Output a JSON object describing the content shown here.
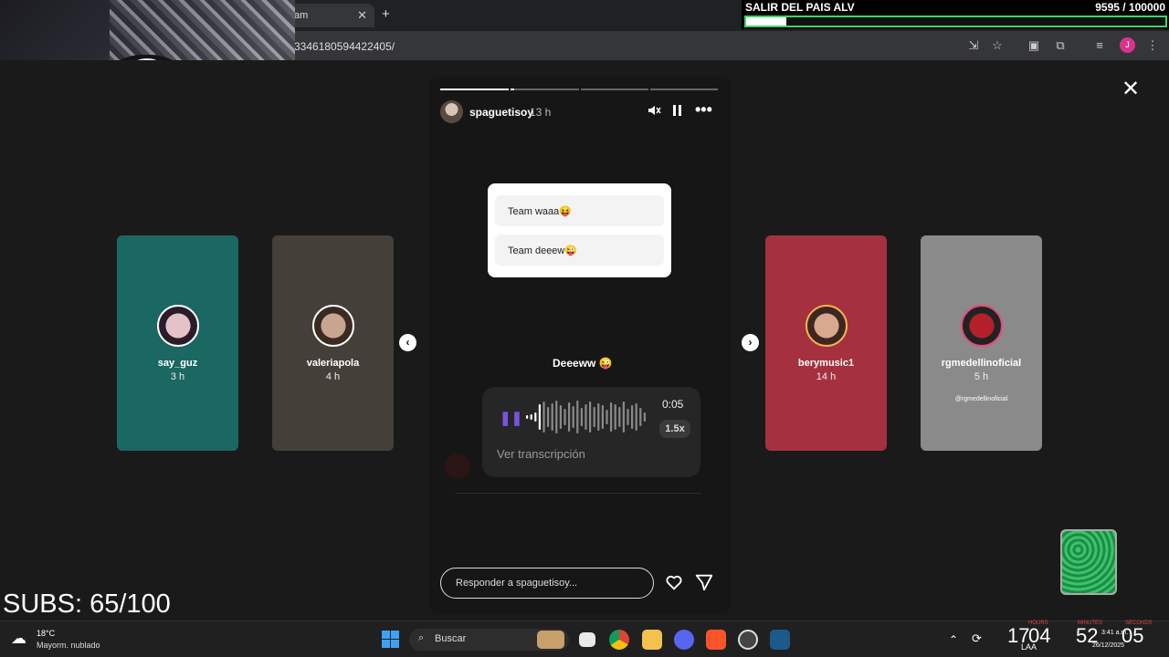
{
  "browser": {
    "tab_title_fragment": "am",
    "tab_close": "✕",
    "new_tab": "+",
    "url_fragment": "3346180594422405/",
    "profile_initial": "J",
    "toolbar_icons": [
      "install-icon",
      "star-icon",
      "tab-search-icon",
      "extensions-icon",
      "media-icon",
      "profile-icon",
      "more-icon"
    ]
  },
  "goal": {
    "title": "SALIR DEL PAIS ALV",
    "count": "9595  / 100000",
    "progress": 0.095,
    "bar_color": "#3bd46a"
  },
  "story": {
    "username": "spaguetisoy",
    "time": "13 h",
    "segments": [
      1.0,
      0.0,
      0.0,
      0.0
    ],
    "current_segment_progress": 0.05,
    "poll_options": [
      "Team waaa😝",
      "Team deeew😜"
    ],
    "caption": "Deeeww 😜",
    "voice_message": {
      "duration": "0:05",
      "speed": "1.5x",
      "transcription_link": "Ver transcripción",
      "accent": "#7a53e0"
    },
    "reply_placeholder": "Responder a spaguetisoy...",
    "close": "✕"
  },
  "side_stories": {
    "left": [
      {
        "name": "say_guz",
        "time": "3 h",
        "bg": "#2a9e96"
      },
      {
        "name": "valeriapola",
        "time": "4 h",
        "bg": "#6b6158"
      }
    ],
    "right": [
      {
        "name": "berymusic1",
        "time": "14 h",
        "bg": "#c23a4c"
      },
      {
        "name": "rgmedellinoficial",
        "time": "5 h",
        "bg": "#9a9a9a",
        "handle": "@rgmedellinoficial"
      }
    ],
    "prev_arrow": "‹",
    "next_arrow": "›"
  },
  "overlay": {
    "subs": "SUBS: 65/100"
  },
  "taskbar": {
    "temperature": "18°C",
    "condition": "Mayorm. nublado",
    "search_label": "Buscar",
    "apps": [
      "file-explorer-icon",
      "chrome-icon",
      "folder-icon",
      "discord-icon",
      "brave-icon",
      "obs-icon",
      "steam-icon"
    ],
    "lang": "LAA",
    "timer_hours": "17",
    "timer_minutes": "04",
    "timer_seconds_a": "52",
    "timer_seconds_b": "05",
    "clock_time": "3:41 a.m.",
    "clock_date": "26/12/2025",
    "timer_labels": [
      "HOURS",
      "MINUTES",
      "SECONDS"
    ]
  }
}
